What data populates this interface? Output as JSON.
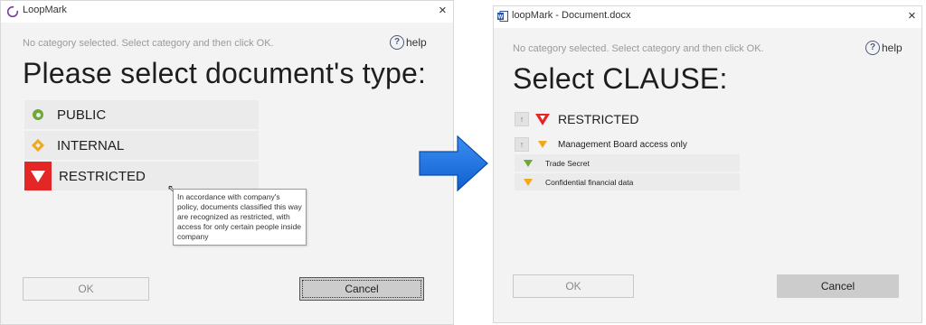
{
  "left_window": {
    "title": "LoopMark",
    "close_glyph": "×",
    "hint": "No category selected. Select category and then click OK.",
    "help_glyph": "?",
    "help_label": "help",
    "heading": "Please select document's type:",
    "options": [
      {
        "label": "PUBLIC",
        "icon": "public-circle-icon",
        "color": "#6ea93a"
      },
      {
        "label": "INTERNAL",
        "icon": "internal-diamond-icon",
        "color": "#f0a91e"
      },
      {
        "label": "RESTRICTED",
        "icon": "restricted-triangle-icon",
        "color": "#e32626"
      }
    ],
    "tooltip": "In accordance with company's policy, documents classified this way are recognized as restricted, with access for only certain people inside company",
    "ok_label": "OK",
    "cancel_label": "Cancel"
  },
  "right_window": {
    "title": "loopMark - Document.docx",
    "close_glyph": "×",
    "hint": "No category selected. Select category and then click OK.",
    "help_glyph": "?",
    "help_label": "help",
    "heading": "Select CLAUSE:",
    "up_glyph": "↑",
    "clauses": [
      {
        "label": "RESTRICTED",
        "icon": "restricted-triangle-icon",
        "color": "#e32626"
      },
      {
        "label": "Management Board access only",
        "icon": "orange-triangle-icon",
        "color": "#f0a91e"
      }
    ],
    "sub_clauses": [
      {
        "label": "Trade Secret",
        "icon": "green-triangle-icon",
        "color": "#6ea93a"
      },
      {
        "label": "Confidential financial data",
        "icon": "orange-triangle-icon",
        "color": "#f0a91e"
      }
    ],
    "ok_label": "OK",
    "cancel_label": "Cancel"
  },
  "colors": {
    "arrow": "#1a73e8",
    "restricted": "#e32626",
    "internal": "#f0a91e",
    "public": "#6ea93a"
  }
}
